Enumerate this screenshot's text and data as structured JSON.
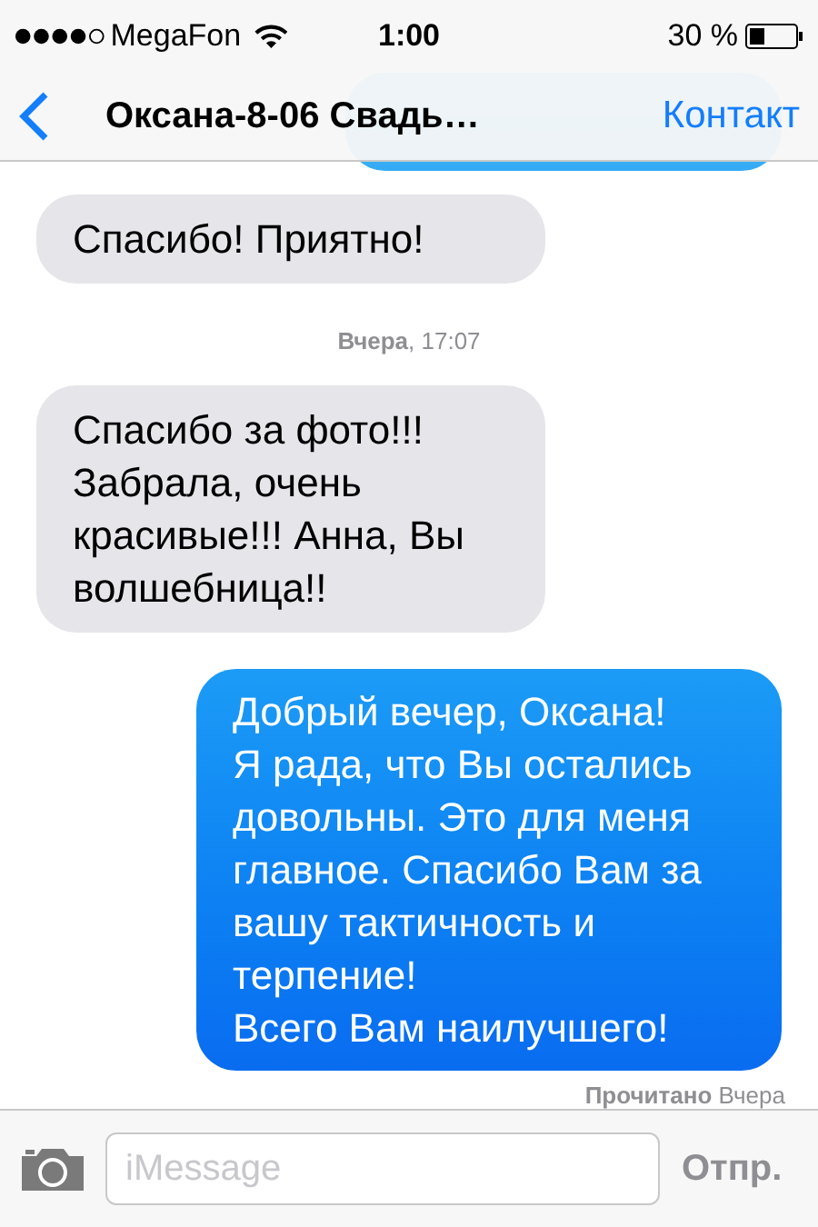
{
  "status_bar": {
    "carrier": "MegaFon",
    "time": "1:00",
    "battery": "30 %"
  },
  "nav": {
    "title": "Оксана-8-06 Свадь…",
    "action": "Контакт"
  },
  "messages": [
    {
      "kind": "incoming",
      "text": "Спасибо! Приятно!"
    },
    {
      "kind": "time",
      "text": "**Вчера**, 17:07"
    },
    {
      "kind": "incoming",
      "text": "Спасибо за фото!!! Забрала, очень красивые!!! Анна, Вы волшебница!!"
    },
    {
      "kind": "outgoing",
      "text": "Добрый вечер, Оксана!\nЯ рада, что Вы остались довольны. Это для меня главное. Спасибо Вам за вашу тактичность и терпение!\nВсего Вам наилучшего!"
    },
    {
      "kind": "receipt",
      "text": "**Прочитано** Вчера"
    }
  ],
  "composer": {
    "placeholder": "iMessage",
    "send": "Отпр."
  }
}
